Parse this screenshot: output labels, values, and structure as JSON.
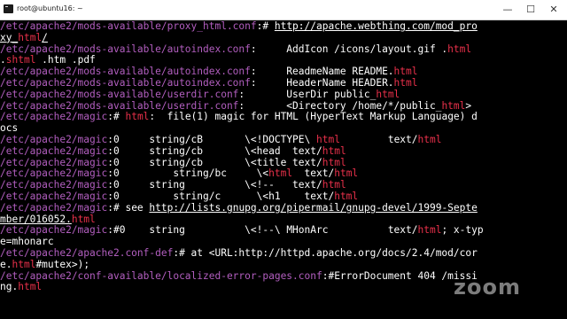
{
  "window": {
    "title": "root@ubuntu16: ~",
    "minimize_glyph": "—",
    "maximize_glyph": "☐",
    "close_glyph": "✕"
  },
  "colors": {
    "path": "#b25ebf",
    "match": "#e8304a",
    "text": "#ffffff",
    "background": "#000000"
  },
  "terminal": {
    "lines": [
      [
        [
          "p",
          "/etc/apache2/mods-available/proxy_html.conf"
        ],
        [
          "w",
          ":# "
        ],
        [
          "u",
          "http://apache.webthing.com/mod_pro"
        ]
      ],
      [
        [
          "u",
          "xy_"
        ],
        [
          "r",
          "html"
        ],
        [
          "u",
          "/"
        ]
      ],
      [
        [
          "p",
          "/etc/apache2/mods-available/autoindex.conf"
        ],
        [
          "w",
          ":     AddIcon /icons/layout.gif ."
        ],
        [
          "r",
          "html"
        ]
      ],
      [
        [
          "w",
          "."
        ],
        [
          "r",
          "shtml"
        ],
        [
          "w",
          " .htm .pdf"
        ]
      ],
      [
        [
          "p",
          "/etc/apache2/mods-available/autoindex.conf"
        ],
        [
          "w",
          ":     ReadmeName README."
        ],
        [
          "r",
          "html"
        ]
      ],
      [
        [
          "p",
          "/etc/apache2/mods-available/autoindex.conf"
        ],
        [
          "w",
          ":     HeaderName HEADER."
        ],
        [
          "r",
          "html"
        ]
      ],
      [
        [
          "p",
          "/etc/apache2/mods-available/userdir.conf"
        ],
        [
          "w",
          ":       UserDir public_"
        ],
        [
          "r",
          "html"
        ]
      ],
      [
        [
          "p",
          "/etc/apache2/mods-available/userdir.conf"
        ],
        [
          "w",
          ":       <Directory /home/*/public_"
        ],
        [
          "r",
          "html"
        ],
        [
          "w",
          "> "
        ]
      ],
      [
        [
          "p",
          "/etc/apache2/magic"
        ],
        [
          "w",
          ":# "
        ],
        [
          "r",
          "html"
        ],
        [
          "w",
          ":  file(1) magic for HTML (HyperText Markup Language) d"
        ]
      ],
      [
        [
          "w",
          "ocs"
        ]
      ],
      [
        [
          "p",
          "/etc/apache2/magic"
        ],
        [
          "w",
          ":0     string/cB       \\<!DOCTYPE\\ "
        ],
        [
          "r",
          "html"
        ],
        [
          "w",
          "        text/"
        ],
        [
          "r",
          "html"
        ]
      ],
      [
        [
          "p",
          "/etc/apache2/magic"
        ],
        [
          "w",
          ":0     string/cb       \\<head  text/"
        ],
        [
          "r",
          "html"
        ]
      ],
      [
        [
          "p",
          "/etc/apache2/magic"
        ],
        [
          "w",
          ":0     string/cb       \\<title text/"
        ],
        [
          "r",
          "html"
        ]
      ],
      [
        [
          "p",
          "/etc/apache2/magic"
        ],
        [
          "w",
          ":0         string/bc     \\<"
        ],
        [
          "r",
          "html"
        ],
        [
          "w",
          "  text/"
        ],
        [
          "r",
          "html"
        ]
      ],
      [
        [
          "p",
          "/etc/apache2/magic"
        ],
        [
          "w",
          ":0     string          \\<!--   text/"
        ],
        [
          "r",
          "html"
        ]
      ],
      [
        [
          "p",
          "/etc/apache2/magic"
        ],
        [
          "w",
          ":0         string/c      \\<h1    text/"
        ],
        [
          "r",
          "html"
        ]
      ],
      [
        [
          "p",
          "/etc/apache2/magic"
        ],
        [
          "w",
          ":# see "
        ],
        [
          "u",
          "http://lists.gnupg.org/pipermail/gnupg-devel/1999-Septe"
        ]
      ],
      [
        [
          "u",
          "mber/016052."
        ],
        [
          "r",
          "html"
        ]
      ],
      [
        [
          "p",
          "/etc/apache2/magic"
        ],
        [
          "w",
          ":#0    string          \\<!--\\ MHonArc          text/"
        ],
        [
          "r",
          "html"
        ],
        [
          "w",
          "; x-typ"
        ]
      ],
      [
        [
          "w",
          "e=mhonarc"
        ]
      ],
      [
        [
          "p",
          "/etc/apache2/apache2.conf-def"
        ],
        [
          "w",
          ":# at <URL:http://httpd.apache.org/docs/2.4/mod/cor"
        ]
      ],
      [
        [
          "w",
          "e."
        ],
        [
          "r",
          "html"
        ],
        [
          "w",
          "#mutex>);"
        ]
      ],
      [
        [
          "p",
          "/etc/apache2/conf-available/localized-error-pages.conf"
        ],
        [
          "w",
          ":#ErrorDocument 404 /missi"
        ]
      ],
      [
        [
          "w",
          "ng."
        ],
        [
          "r",
          "html"
        ]
      ]
    ]
  },
  "watermark": "zoom"
}
